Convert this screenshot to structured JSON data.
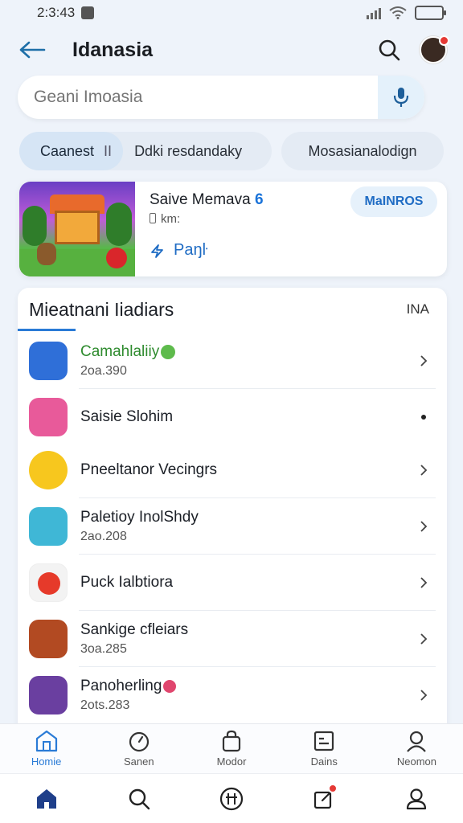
{
  "status_bar": {
    "time": "2:3:43"
  },
  "header": {
    "title": "Idanasia"
  },
  "search": {
    "placeholder": "Geani Imoasia"
  },
  "chips": {
    "active": "Caanest",
    "separator": "II",
    "second": "Ddki resdandaky",
    "third": "Mosasianalodign"
  },
  "featured": {
    "title": "Saive Memava",
    "title_badge": "6",
    "subtitle": "km:",
    "link": "Paŋŀ",
    "pill": "MaINROS"
  },
  "list": {
    "title": "Mieatnani Iiadiars",
    "meta": "INA",
    "items": [
      {
        "name": "Camahlaliiy",
        "sub": "2oa.390",
        "trailing": "chevron",
        "icon_color": "#2f6fd8",
        "name_color": "green"
      },
      {
        "name": "Saisie Slohim",
        "sub": "",
        "trailing": "dot",
        "icon_color": "#e85a9a"
      },
      {
        "name": "Pneeltanor Vecingrs",
        "sub": "",
        "trailing": "chevron",
        "icon_color": "#f7c71e"
      },
      {
        "name": "Paletioy InolShdy",
        "sub": "2ao.208",
        "trailing": "chevron",
        "icon_color": "#3fb7d6"
      },
      {
        "name": "Puck Ialbtiora",
        "sub": "",
        "trailing": "chevron",
        "icon_color": "#e63a2a"
      },
      {
        "name": "Sankige cfleiars",
        "sub": "3oa.285",
        "trailing": "chevron",
        "icon_color": "#b24a22"
      },
      {
        "name": "Panoherling",
        "sub": "2ots.283",
        "trailing": "chevron",
        "icon_color": "#6a3fa0"
      }
    ]
  },
  "tabbar": {
    "items": [
      {
        "label": "Homie",
        "icon": "store-icon",
        "active": true
      },
      {
        "label": "Sanen",
        "icon": "timer-icon"
      },
      {
        "label": "Modor",
        "icon": "bag-icon"
      },
      {
        "label": "Dains",
        "icon": "document-icon"
      },
      {
        "label": "Neomon",
        "icon": "person-icon"
      }
    ]
  },
  "bottomnav": {
    "items": [
      {
        "icon": "home-icon"
      },
      {
        "icon": "search-icon"
      },
      {
        "icon": "grid-icon"
      },
      {
        "icon": "edit-icon",
        "badge": true
      },
      {
        "icon": "profile-icon"
      }
    ]
  },
  "colors": {
    "accent": "#2a7bd6",
    "brand_dark": "#1f3f8a",
    "verified": "#5ebb4c"
  }
}
